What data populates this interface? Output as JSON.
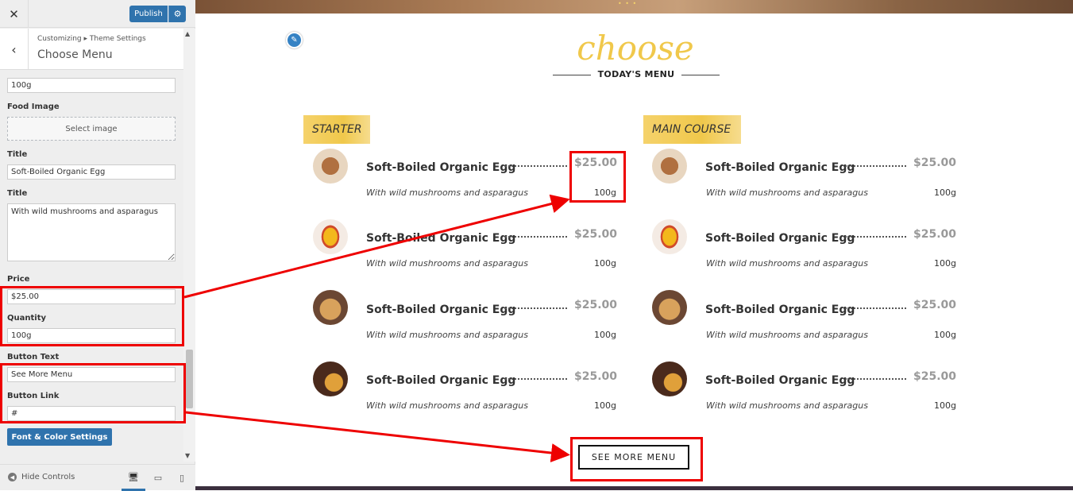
{
  "topbar": {
    "close_glyph": "✕",
    "publish_label": "Publish",
    "gear_icon": "gear-icon"
  },
  "section": {
    "breadcrumb": "Customizing ▸ Theme Settings",
    "title": "Choose Menu"
  },
  "fields": {
    "quantity_top": "100g",
    "food_image_label": "Food Image",
    "select_image_label": "Select image",
    "title_label": "Title",
    "title_value": "Soft-Boiled Organic Egg",
    "title2_label": "Title",
    "description_value": "With wild mushrooms and asparagus",
    "price_label": "Price",
    "price_value": "$25.00",
    "quantity_label": "Quantity",
    "quantity_value": "100g",
    "button_text_label": "Button Text",
    "button_text_value": "See More Menu",
    "button_link_label": "Button Link",
    "button_link_value": "#",
    "font_color_button": "Font & Color Settings"
  },
  "footer": {
    "hide_controls": "Hide Controls"
  },
  "preview": {
    "script_title": "choose",
    "subtitle": "TODAY'S MENU",
    "see_more": "SEE MORE MENU",
    "categories": [
      {
        "name": "STARTER",
        "items": [
          {
            "name": "Soft-Boiled Organic Egg",
            "price": "$25.00",
            "desc": "With wild mushrooms and asparagus",
            "qty": "100g"
          },
          {
            "name": "Soft-Boiled Organic Egg",
            "price": "$25.00",
            "desc": "With wild mushrooms and asparagus",
            "qty": "100g"
          },
          {
            "name": "Soft-Boiled Organic Egg",
            "price": "$25.00",
            "desc": "With wild mushrooms and asparagus",
            "qty": "100g"
          },
          {
            "name": "Soft-Boiled Organic Egg",
            "price": "$25.00",
            "desc": "With wild mushrooms and asparagus",
            "qty": "100g"
          }
        ]
      },
      {
        "name": "MAIN COURSE",
        "items": [
          {
            "name": "Soft-Boiled Organic Egg",
            "price": "$25.00",
            "desc": "With wild mushrooms and asparagus",
            "qty": "100g"
          },
          {
            "name": "Soft-Boiled Organic Egg",
            "price": "$25.00",
            "desc": "With wild mushrooms and asparagus",
            "qty": "100g"
          },
          {
            "name": "Soft-Boiled Organic Egg",
            "price": "$25.00",
            "desc": "With wild mushrooms and asparagus",
            "qty": "100g"
          },
          {
            "name": "Soft-Boiled Organic Egg",
            "price": "$25.00",
            "desc": "With wild mushrooms and asparagus",
            "qty": "100g"
          }
        ]
      }
    ]
  },
  "colors": {
    "accent": "#2f73ad",
    "gold": "#f0c84b",
    "annotation": "#ee0000"
  }
}
